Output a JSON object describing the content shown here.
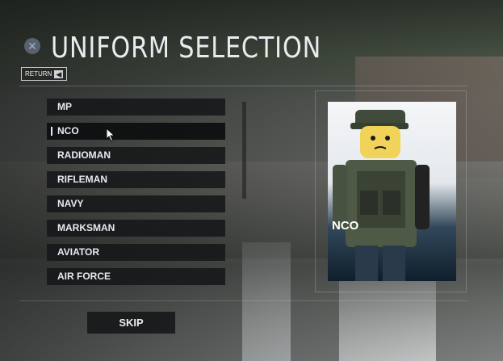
{
  "title": "UNIFORM SELECTION",
  "return_label": "RETURN",
  "close_icon": "x-circle-icon",
  "uniforms": [
    {
      "label": "MP"
    },
    {
      "label": "NCO",
      "selected": true
    },
    {
      "label": "RADIOMAN"
    },
    {
      "label": "RIFLEMAN"
    },
    {
      "label": "NAVY"
    },
    {
      "label": "MARKSMAN"
    },
    {
      "label": "AVIATOR"
    },
    {
      "label": "AIR FORCE"
    }
  ],
  "preview": {
    "label": "NCO"
  },
  "skip_label": "SKIP"
}
